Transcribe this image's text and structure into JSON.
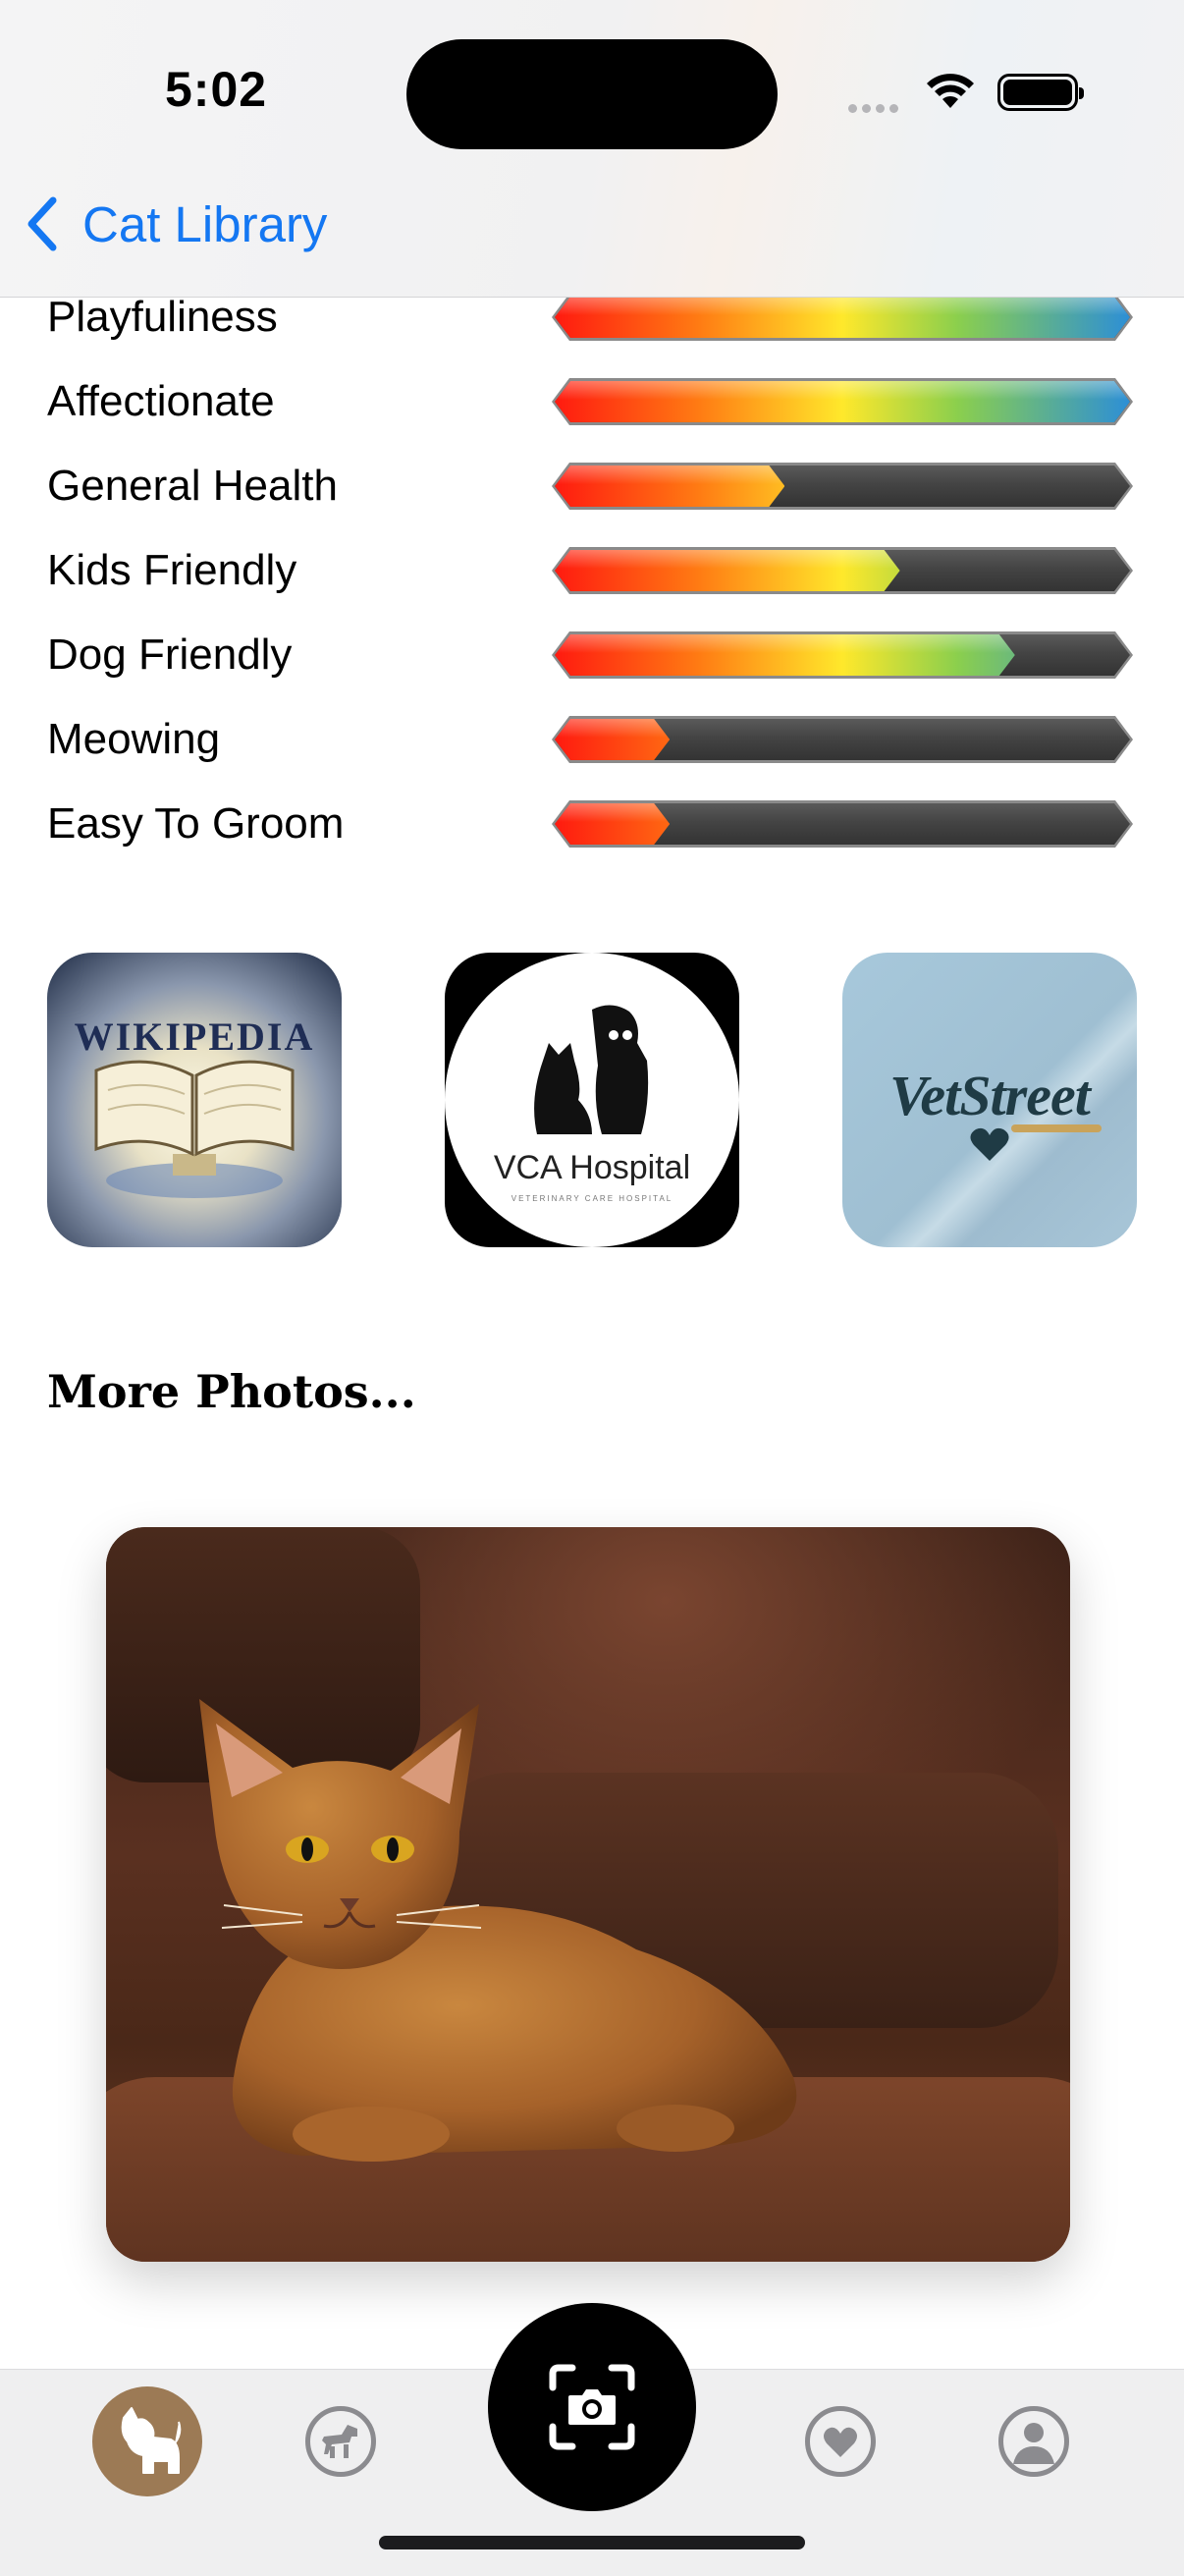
{
  "status_bar": {
    "time": "5:02"
  },
  "nav": {
    "back_label": "Cat Library"
  },
  "stats": [
    {
      "label": "Playfuliness",
      "level": 1.0
    },
    {
      "label": "Affectionate",
      "level": 1.0
    },
    {
      "label": "General Health",
      "level": 0.4
    },
    {
      "label": "Kids Friendly",
      "level": 0.6
    },
    {
      "label": "Dog Friendly",
      "level": 0.8
    },
    {
      "label": "Meowing",
      "level": 0.2
    },
    {
      "label": "Easy To Groom",
      "level": 0.2
    }
  ],
  "links": {
    "wikipedia": {
      "logo_text": "WIKIPEDIA"
    },
    "vca": {
      "logo_text": "VCA Hospital",
      "sub_text": "VETERINARY CARE HOSPITAL"
    },
    "vetstreet": {
      "logo_text": "VetStreet"
    }
  },
  "more_photos": {
    "title": "More Photos..."
  },
  "colors": {
    "accent": "#1477f2",
    "tab_active": "#9c7a55",
    "tab_inactive": "#8b8b8f"
  },
  "tabs": [
    {
      "icon": "cat-icon",
      "active": true
    },
    {
      "icon": "dog-icon",
      "active": false
    },
    {
      "icon": "camera-scan-icon",
      "active": false
    },
    {
      "icon": "heart-icon",
      "active": false
    },
    {
      "icon": "person-icon",
      "active": false
    }
  ]
}
